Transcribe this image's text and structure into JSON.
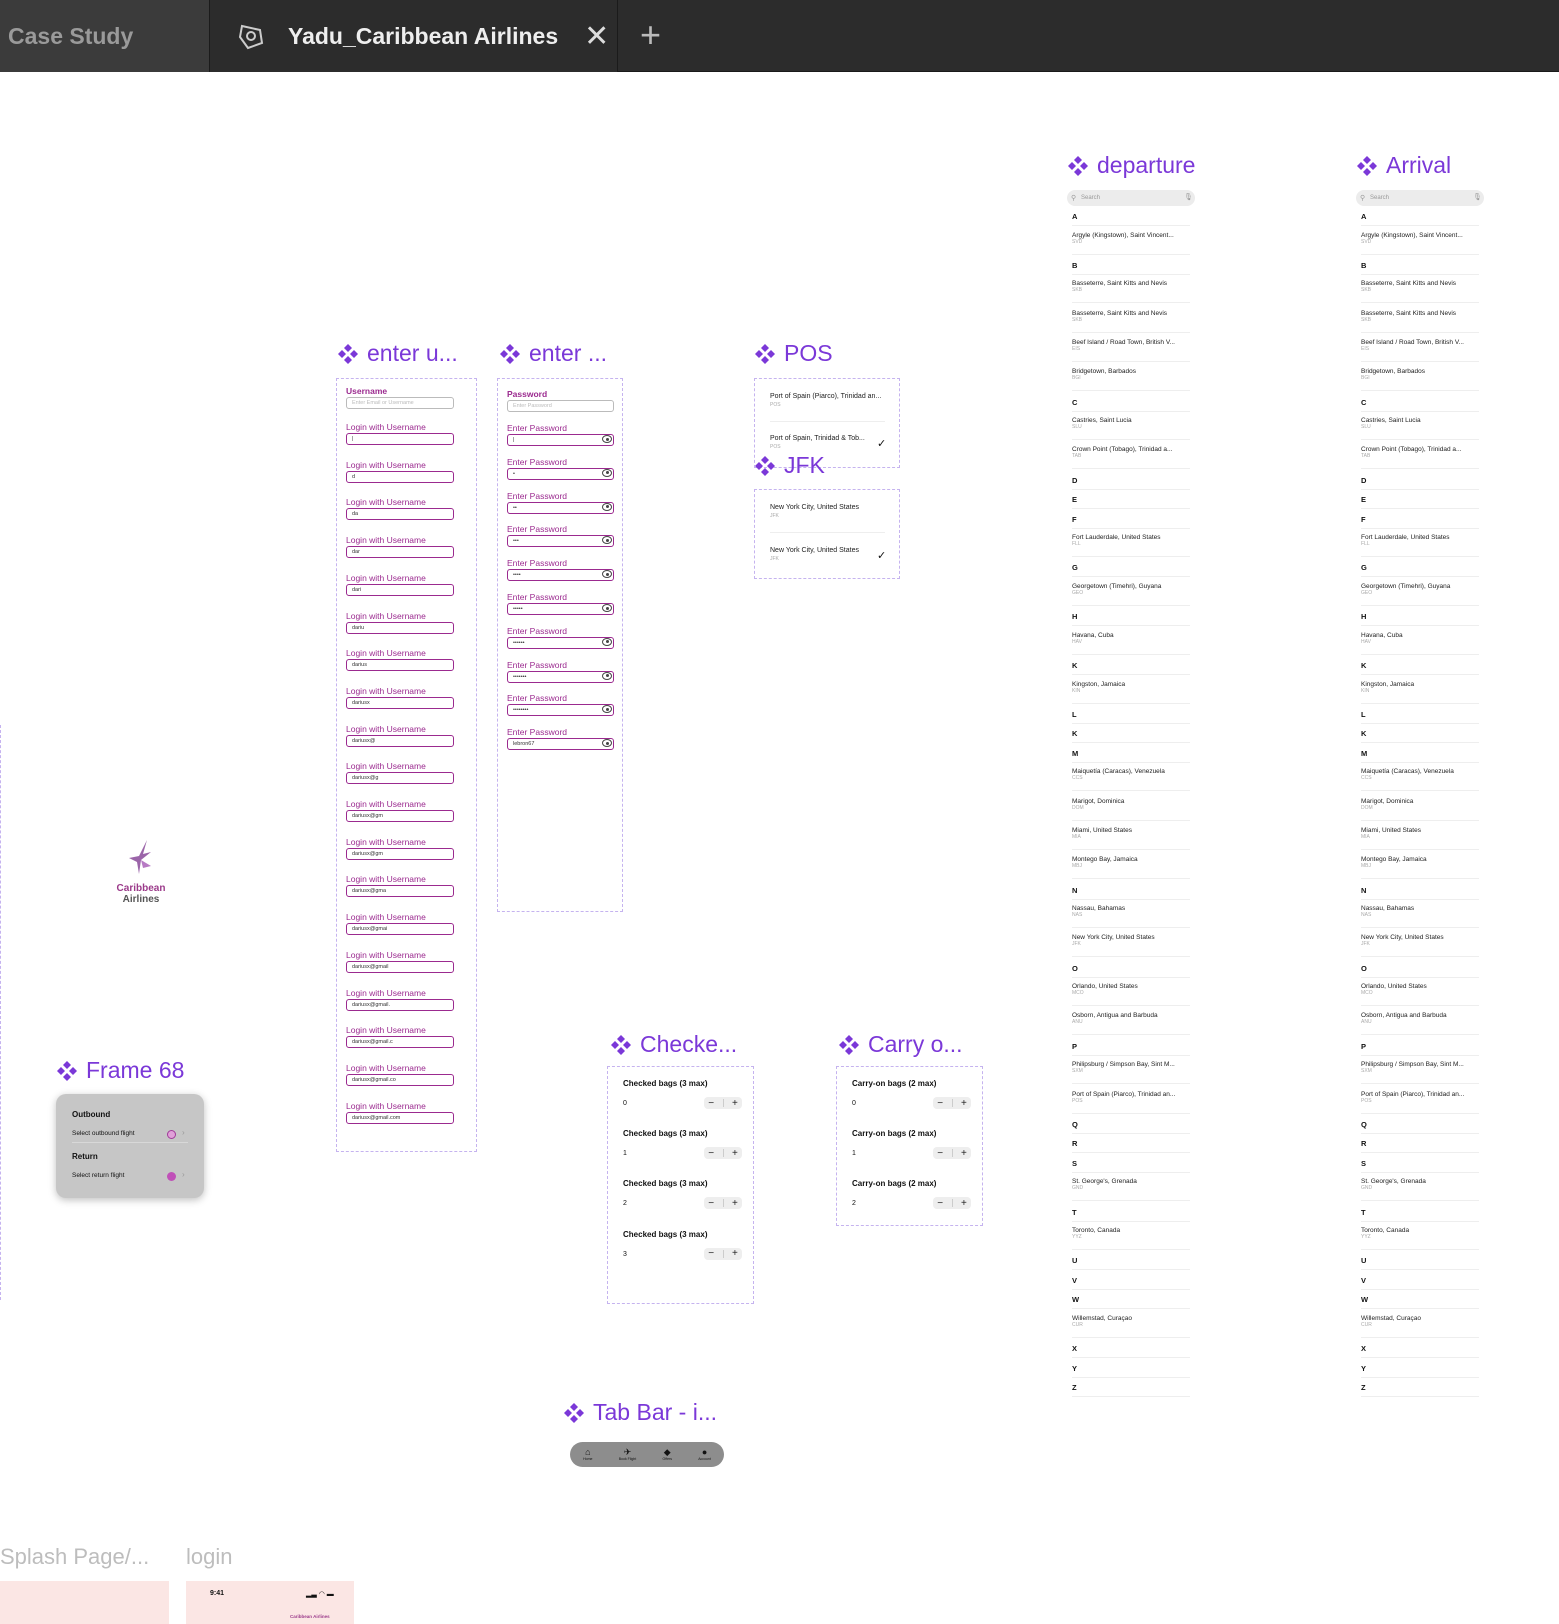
{
  "tabs": {
    "prev": "Case Study",
    "active": "Yadu_Caribbean Airlines",
    "close": "✕",
    "new": "+"
  },
  "components": {
    "enter_username": {
      "title": "enter u...",
      "first_label": "Username",
      "first_placeholder": "Enter Email or Username",
      "label": "Login with Username",
      "values": [
        "|",
        "d",
        "da",
        "dar",
        "dari",
        "dariu",
        "darius",
        "dariusx",
        "dariusx@",
        "dariusx@g",
        "dariusx@gm",
        "dariusx@gm",
        "dariusx@gma",
        "dariusx@gmai",
        "dariusx@gmail",
        "dariusx@gmail.",
        "dariusx@gmail.c",
        "dariusx@gmail.co",
        "dariusx@gmail.com"
      ]
    },
    "enter_password": {
      "title": "enter ...",
      "first_label": "Password",
      "first_placeholder": "Enter Password",
      "label": "Enter Password",
      "values": [
        "|",
        "•",
        "••",
        "•••",
        "••••",
        "•••••",
        "••••••",
        "•••••••",
        "••••••••",
        "lebron67"
      ]
    },
    "pos": {
      "title": "POS",
      "opt1": "Port of Spain (Piarco), Trinidad an...",
      "opt1_code": "POS",
      "opt2": "Port of Spain, Trinidad & Tob...",
      "opt2_code": "POS",
      "check": "✓"
    },
    "jfk": {
      "title": "JFK",
      "opt1": "New York City, United States",
      "opt1_code": "JFK",
      "opt2": "New York City, United States",
      "opt2_code": "JFK",
      "check": "✓"
    },
    "checked": {
      "title": "Checke...",
      "label": "Checked bags (3 max)",
      "values": [
        "0",
        "1",
        "2",
        "3"
      ],
      "minus": "−",
      "plus": "+"
    },
    "carry": {
      "title": "Carry o...",
      "label": "Carry-on bags (2 max)",
      "values": [
        "0",
        "1",
        "2"
      ],
      "minus": "−",
      "plus": "+"
    },
    "frame68": {
      "title": "Frame 68",
      "outbound": "Outbound",
      "select_outbound": "Select outbound flight",
      "return": "Return",
      "select_return": "Select return flight"
    },
    "logo": {
      "line1": "Caribbean",
      "line2": "Airlines"
    },
    "tabbar_comp": {
      "title": "Tab Bar - i...",
      "items": [
        "Home",
        "Book Flight",
        "Offers",
        "Account"
      ]
    },
    "splash": {
      "title": "Splash Page/..."
    },
    "login": {
      "title": "login",
      "time": "9:41",
      "brand": "Caribbean Airlines"
    }
  },
  "departure": {
    "title": "departure",
    "search": "Search"
  },
  "arrival": {
    "title": "Arrival",
    "search": "Search"
  },
  "airport_list": [
    {
      "t": "L",
      "v": "A"
    },
    {
      "t": "R",
      "v": "Argyle (Kingstown), Saint Vincent...",
      "c": "SVD"
    },
    {
      "t": "L",
      "v": "B"
    },
    {
      "t": "R",
      "v": "Basseterre, Saint Kitts and Nevis",
      "c": "SKB"
    },
    {
      "t": "R",
      "v": "Basseterre, Saint Kitts and Nevis",
      "c": "SKB"
    },
    {
      "t": "R",
      "v": "Beef Island / Road Town, British V...",
      "c": "EIS"
    },
    {
      "t": "R",
      "v": "Bridgetown, Barbados",
      "c": "BGI"
    },
    {
      "t": "L",
      "v": "C"
    },
    {
      "t": "R",
      "v": "Castries, Saint Lucia",
      "c": "SLU"
    },
    {
      "t": "R",
      "v": "Crown Point (Tobago), Trinidad a...",
      "c": "TAB"
    },
    {
      "t": "L",
      "v": "D"
    },
    {
      "t": "L",
      "v": "E"
    },
    {
      "t": "L",
      "v": "F"
    },
    {
      "t": "R",
      "v": "Fort Lauderdale, United States",
      "c": "FLL"
    },
    {
      "t": "L",
      "v": "G"
    },
    {
      "t": "R",
      "v": "Georgetown (Timehri), Guyana",
      "c": "GEO"
    },
    {
      "t": "L",
      "v": "H"
    },
    {
      "t": "R",
      "v": "Havana, Cuba",
      "c": "HAV"
    },
    {
      "t": "L",
      "v": "K"
    },
    {
      "t": "R",
      "v": "Kingston, Jamaica",
      "c": "KIN"
    },
    {
      "t": "L",
      "v": "L"
    },
    {
      "t": "L",
      "v": "K"
    },
    {
      "t": "L",
      "v": "M"
    },
    {
      "t": "R",
      "v": "Maiquetía (Caracas), Venezuela",
      "c": "CCS"
    },
    {
      "t": "R",
      "v": "Marigot, Dominica",
      "c": "DOM"
    },
    {
      "t": "R",
      "v": "Miami, United States",
      "c": "MIA"
    },
    {
      "t": "R",
      "v": "Montego Bay, Jamaica",
      "c": "MBJ"
    },
    {
      "t": "L",
      "v": "N"
    },
    {
      "t": "R",
      "v": "Nassau, Bahamas",
      "c": "NAS"
    },
    {
      "t": "R",
      "v": "New York City, United States",
      "c": "JFK"
    },
    {
      "t": "L",
      "v": "O"
    },
    {
      "t": "R",
      "v": "Orlando, United States",
      "c": "MCO"
    },
    {
      "t": "R",
      "v": "Osborn, Antigua and Barbuda",
      "c": "ANU"
    },
    {
      "t": "L",
      "v": "P"
    },
    {
      "t": "R",
      "v": "Philipsburg / Simpson Bay, Sint M...",
      "c": "SXM"
    },
    {
      "t": "R",
      "v": "Port of Spain (Piarco), Trinidad an...",
      "c": "POS"
    },
    {
      "t": "L",
      "v": "Q"
    },
    {
      "t": "L",
      "v": "R"
    },
    {
      "t": "L",
      "v": "S"
    },
    {
      "t": "R",
      "v": "St. George's, Grenada",
      "c": "GND"
    },
    {
      "t": "L",
      "v": "T"
    },
    {
      "t": "R",
      "v": "Toronto, Canada",
      "c": "YYZ"
    },
    {
      "t": "L",
      "v": "U"
    },
    {
      "t": "L",
      "v": "V"
    },
    {
      "t": "L",
      "v": "W"
    },
    {
      "t": "R",
      "v": "Willemstad, Curaçao",
      "c": "CUR"
    },
    {
      "t": "L",
      "v": "X"
    },
    {
      "t": "L",
      "v": "Y"
    },
    {
      "t": "L",
      "v": "Z"
    }
  ],
  "colors": {
    "accent": "#7b38d8",
    "magenta": "#9b2a8f",
    "topbar": "#2c2c2c"
  },
  "icons": {
    "component": "component-diamond-icon",
    "tab": "figma-file-icon"
  }
}
